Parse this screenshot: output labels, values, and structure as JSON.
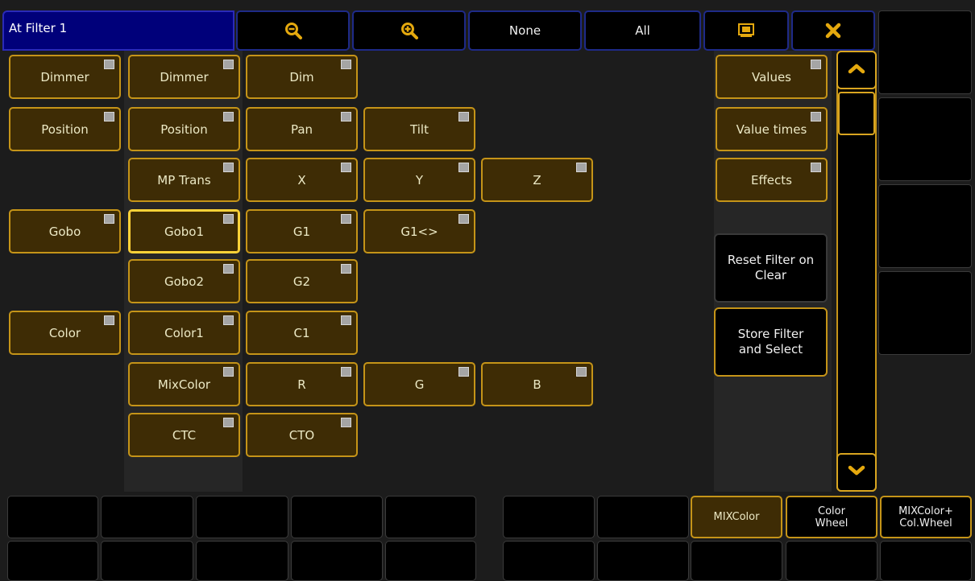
{
  "window": {
    "title": "At Filter 1"
  },
  "toolbar": {
    "zoom_out_icon": "zoom-out-icon",
    "zoom_in_icon": "zoom-in-icon",
    "none_label": "None",
    "all_label": "All",
    "screen_icon": "screen-icon",
    "close_icon": "close-icon"
  },
  "filters": {
    "dimmer": "Dimmer",
    "dimmer2": "Dimmer",
    "dim": "Dim",
    "position": "Position",
    "position2": "Position",
    "pan": "Pan",
    "tilt": "Tilt",
    "mptrans": "MP Trans",
    "x": "X",
    "y": "Y",
    "z": "Z",
    "gobo": "Gobo",
    "gobo1": "Gobo1",
    "g1": "G1",
    "g1rot": "G1<>",
    "gobo2": "Gobo2",
    "g2": "G2",
    "color": "Color",
    "color1": "Color1",
    "c1": "C1",
    "mixcolor": "MixColor",
    "r": "R",
    "g": "G",
    "b": "B",
    "ctc": "CTC",
    "cto": "CTO"
  },
  "options": {
    "values": "Values",
    "value_times": "Value times",
    "effects": "Effects",
    "reset_filter": "Reset Filter on Clear",
    "store_filter": "Store Filter and Select"
  },
  "color_mode": {
    "mixcolor": "MIXColor",
    "color_wheel": "Color Wheel",
    "mix_and_wheel": "MIXColor+ Col.Wheel",
    "selected": "MIXColor"
  },
  "colors": {
    "accent": "#c59418",
    "button_fill": "#3e2c05",
    "title_bg": "#00007a"
  }
}
